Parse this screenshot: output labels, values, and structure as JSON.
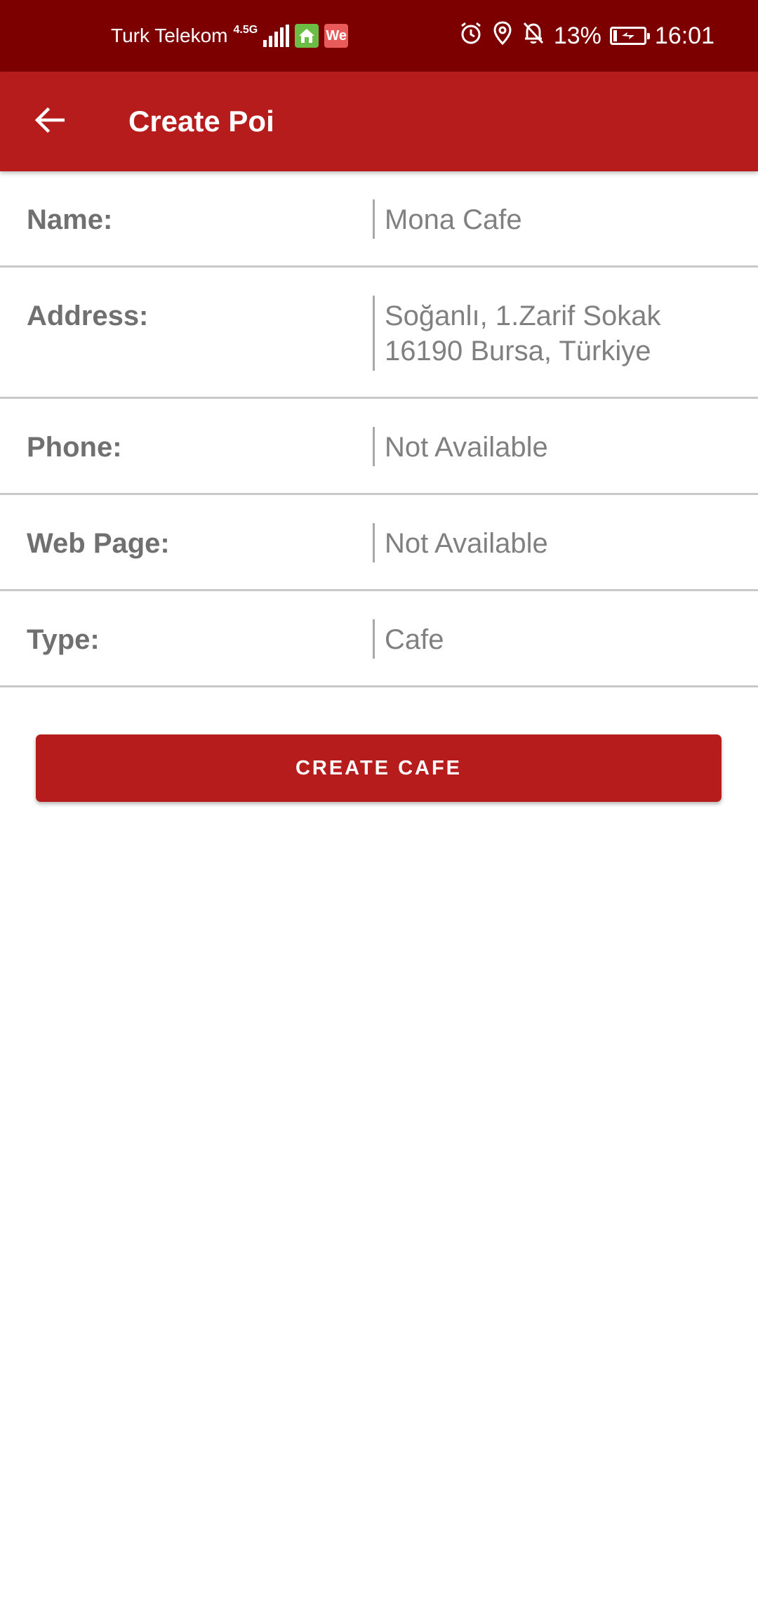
{
  "status_bar": {
    "carrier": "Turk Telekom",
    "network_type": "4.5G",
    "battery_percent": "13%",
    "time": "16:01",
    "icons": [
      "signal-icon",
      "home-app-icon",
      "we-app-icon",
      "alarm-icon",
      "location-icon",
      "bell-off-icon",
      "battery-charging-icon"
    ],
    "we_badge": "We",
    "battery_level": 0.13,
    "colors": {
      "background": "#7d0000",
      "home_badge": "#6cbd45",
      "we_badge": "#e95b5b"
    }
  },
  "app_bar": {
    "title": "Create Poi",
    "back_icon": "arrow-left-icon",
    "background": "#b71c1c"
  },
  "form": {
    "name_label": "Name:",
    "name_value": "Mona Cafe",
    "address_label": "Address:",
    "address_value": "Soğanlı, 1.Zarif Sokak\n16190 Bursa, Türkiye",
    "phone_label": "Phone:",
    "phone_value": "Not Available",
    "web_label": "Web Page:",
    "web_value": "Not Available",
    "type_label": "Type:",
    "type_value": "Cafe"
  },
  "actions": {
    "create_label": "CREATE CAFE",
    "accent": "#b71c1c"
  }
}
